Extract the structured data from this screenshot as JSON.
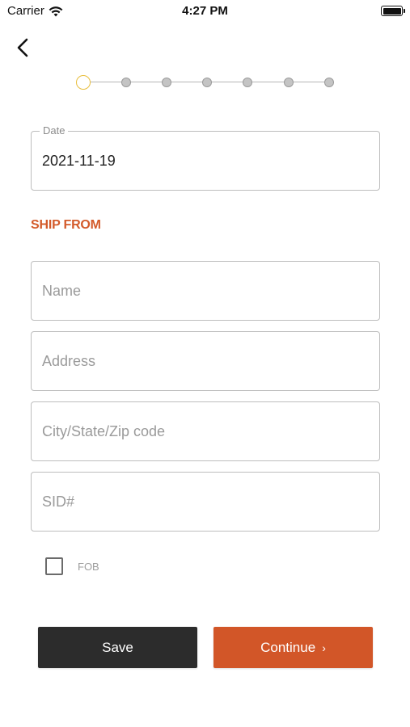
{
  "status_bar": {
    "carrier": "Carrier",
    "time": "4:27 PM"
  },
  "stepper": {
    "total_steps": 7,
    "current_step": 1,
    "active_color": "#e8be3c"
  },
  "date_field": {
    "label": "Date",
    "value": "2021-11-19"
  },
  "ship_from": {
    "title": "SHIP FROM",
    "name_placeholder": "Name",
    "address_placeholder": "Address",
    "city_placeholder": "City/State/Zip code",
    "sid_placeholder": "SID#"
  },
  "fob": {
    "label": "FOB",
    "checked": false
  },
  "buttons": {
    "save": "Save",
    "continue": "Continue",
    "continue_icon": "chevron-right-icon"
  },
  "colors": {
    "accent": "#d25628",
    "dark_button": "#2c2c2c"
  }
}
